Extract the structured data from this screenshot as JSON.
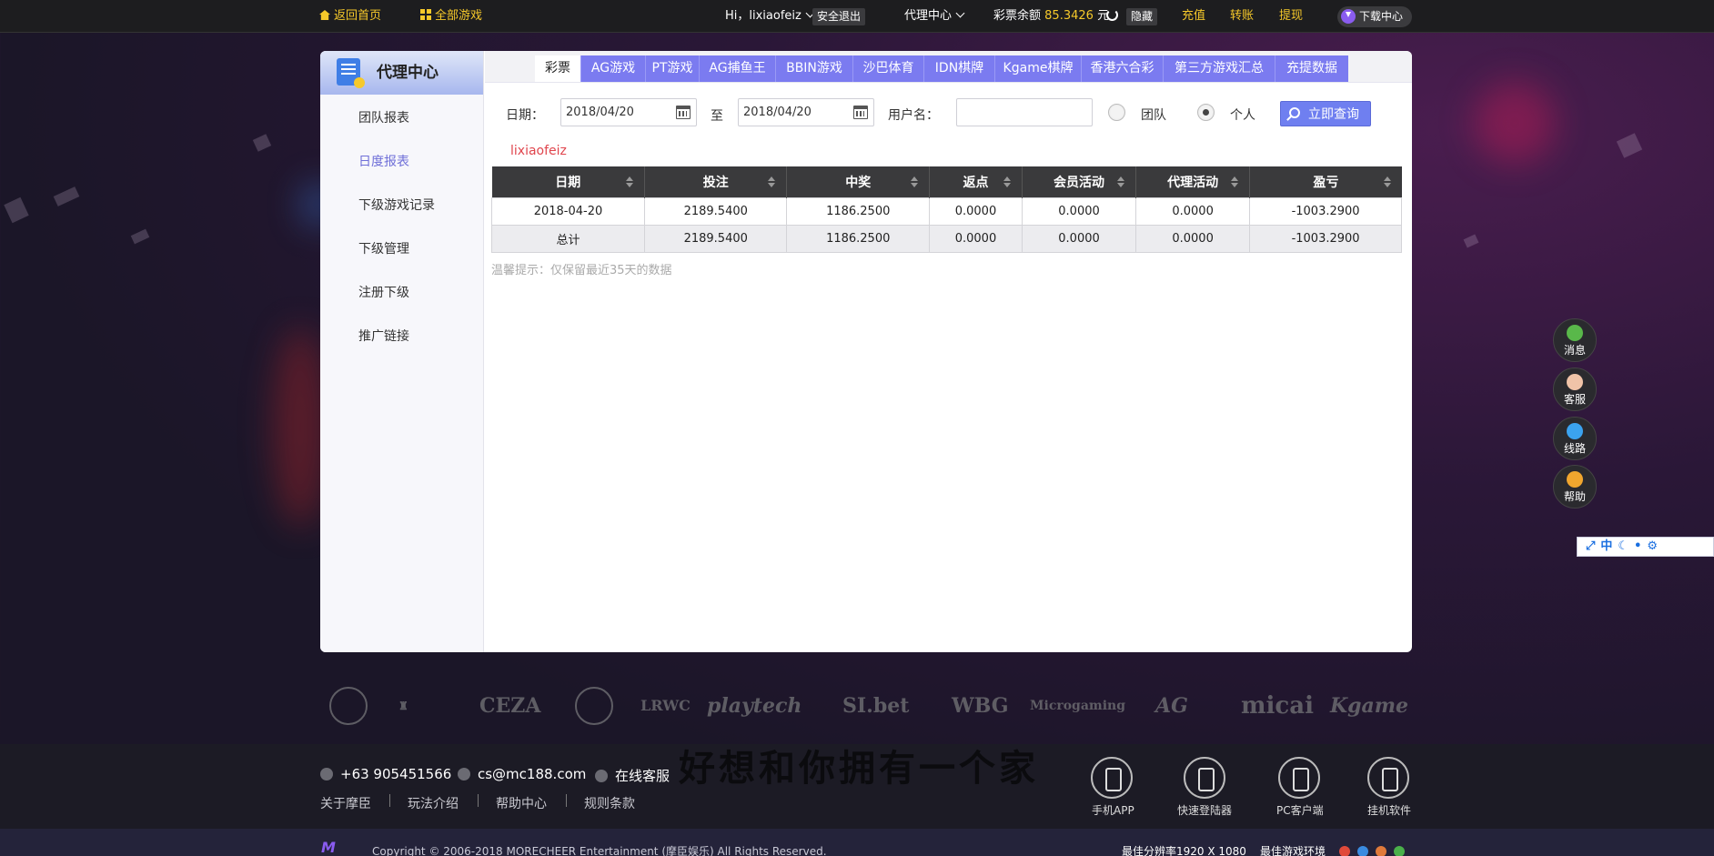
{
  "topbar": {
    "home": "返回首页",
    "all_games": "全部游戏",
    "greeting": "Hi，lixiaofeiz",
    "logout": "安全退出",
    "agent_center": "代理中心",
    "balance_label": "彩票余额",
    "balance_value": "85.3426",
    "balance_unit": "元",
    "hide": "隐藏",
    "deposit": "充值",
    "transfer": "转账",
    "withdraw": "提现",
    "download": "下载中心"
  },
  "sidebar": {
    "title": "代理中心",
    "items": [
      {
        "label": "团队报表",
        "active": false
      },
      {
        "label": "日度报表",
        "active": true
      },
      {
        "label": "下级游戏记录",
        "active": false
      },
      {
        "label": "下级管理",
        "active": false
      },
      {
        "label": "注册下级",
        "active": false
      },
      {
        "label": "推广链接",
        "active": false
      }
    ]
  },
  "tabs": [
    "彩票",
    "AG游戏",
    "PT游戏",
    "AG捕鱼王",
    "BBIN游戏",
    "沙巴体育",
    "IDN棋牌",
    "Kgame棋牌",
    "香港六合彩",
    "第三方游戏汇总",
    "充提数据"
  ],
  "active_tab": "彩票",
  "form": {
    "date_label": "日期：",
    "date_from": "2018/04/20",
    "to_label": "至",
    "date_to": "2018/04/20",
    "username_label": "用户名：",
    "username_value": "",
    "team_label": "团队",
    "personal_label": "个人",
    "selected_scope": "个人",
    "search_button": "立即查询"
  },
  "result_username": "lixiaofeiz",
  "table": {
    "headers": [
      "日期",
      "投注",
      "中奖",
      "返点",
      "会员活动",
      "代理活动",
      "盈亏"
    ],
    "rows": [
      [
        "2018-04-20",
        "2189.5400",
        "1186.2500",
        "0.0000",
        "0.0000",
        "0.0000",
        "-1003.2900"
      ]
    ],
    "total": [
      "总计",
      "2189.5400",
      "1186.2500",
      "0.0000",
      "0.0000",
      "0.0000",
      "-1003.2900"
    ]
  },
  "hint": "温馨提示：仅保留最近35天的数据",
  "float_buttons": [
    {
      "label": "消息",
      "color": "#59b84a"
    },
    {
      "label": "客服",
      "color": "#f0c3a8"
    },
    {
      "label": "线路",
      "color": "#3ba3ef"
    },
    {
      "label": "帮助",
      "color": "#f0a62e"
    }
  ],
  "ime_toolbar": "中",
  "partners": [
    "CEZA",
    "LRWC",
    "playtech",
    "SI.bet",
    "WBG",
    "Microgaming",
    "AG",
    "micai",
    "Kgame"
  ],
  "footer": {
    "phone": "+63 905451566",
    "email": "cs@mc188.com",
    "online_service": "在线客服",
    "links": [
      "关于摩臣",
      "玩法介绍",
      "帮助中心",
      "规则条款"
    ],
    "slogan": "好想和你拥有一个家",
    "apps": [
      "手机APP",
      "快速登陆器",
      "PC客户端",
      "挂机软件"
    ],
    "copyright": "Copyright © 2006-2018 MORECHEER Entertainment (摩臣娱乐) All Rights Reserved.",
    "resolution": "最佳分辨率1920 X 1080",
    "env": "最佳游戏环境"
  },
  "colors": {
    "accent_tab": "#7b7bf0",
    "yellow": "#f6c92a",
    "table_header": "#3a3a3c",
    "username_red": "#e0454d"
  }
}
